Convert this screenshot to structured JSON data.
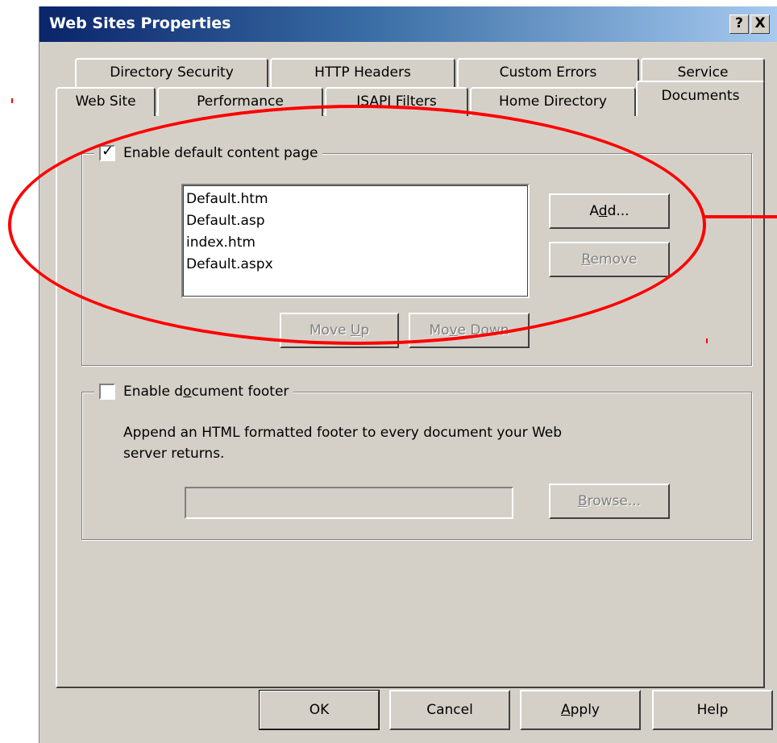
{
  "window": {
    "title": "Web Sites Properties",
    "help_btn": "?",
    "close_btn": "X"
  },
  "tabs": {
    "row1": [
      {
        "label": "Directory Security"
      },
      {
        "label": "HTTP Headers"
      },
      {
        "label": "Custom Errors"
      },
      {
        "label": "Service"
      }
    ],
    "row2": [
      {
        "label": "Web Site"
      },
      {
        "label": "Performance"
      },
      {
        "label": "ISAPI Filters"
      },
      {
        "label": "Home Directory"
      },
      {
        "label": "Documents",
        "active": true
      }
    ]
  },
  "default_content": {
    "checkbox_label": "Enable default content page",
    "checked": true,
    "documents": [
      "Default.htm",
      "Default.asp",
      "index.htm",
      "Default.aspx"
    ],
    "add_btn": {
      "pre": "A",
      "key": "d",
      "post": "d..."
    },
    "remove_btn": {
      "pre": "",
      "key": "R",
      "post": "emove"
    },
    "move_up_btn": {
      "pre": "Move ",
      "key": "U",
      "post": "p"
    },
    "move_down_btn": {
      "pre": "Mo",
      "key": "v",
      "post": "e Down"
    }
  },
  "footer": {
    "checkbox_label": {
      "pre": "Enable d",
      "key": "o",
      "post": "cument footer"
    },
    "checked": false,
    "description_line1": "Append an HTML formatted footer to every document your Web",
    "description_line2": "server returns.",
    "path_value": "",
    "browse_btn": {
      "pre": "",
      "key": "B",
      "post": "rowse..."
    }
  },
  "buttons": {
    "ok": "OK",
    "cancel": "Cancel",
    "apply": {
      "pre": "",
      "key": "A",
      "post": "pply"
    },
    "help": "Help"
  },
  "colors": {
    "annotation": "#ff0000",
    "face": "#d4d0c8",
    "title_start": "#0a246a"
  }
}
